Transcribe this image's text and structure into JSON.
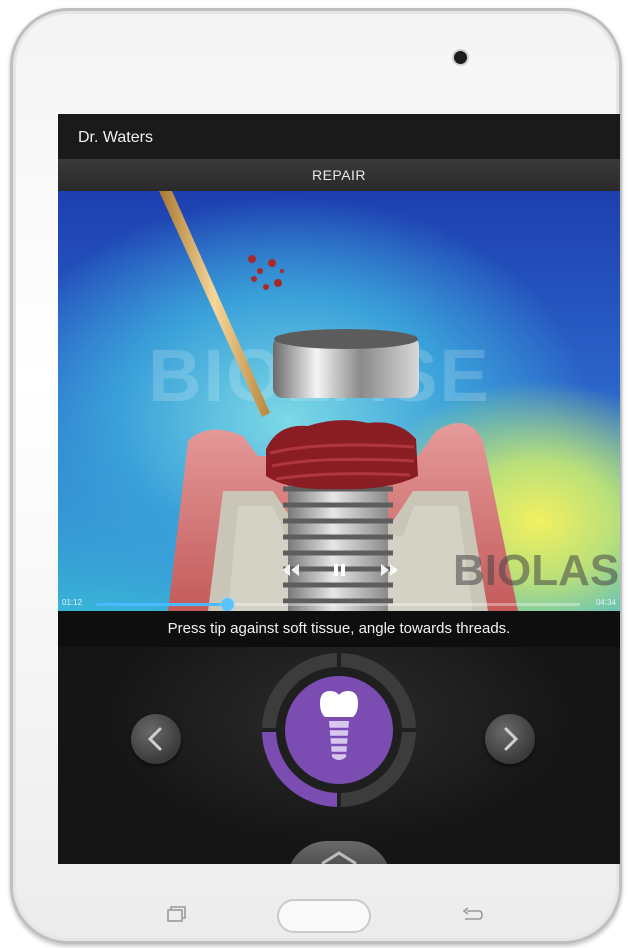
{
  "header": {
    "title": "Dr. Waters"
  },
  "section": {
    "label": "REPAIR"
  },
  "video": {
    "elapsed": "01:12",
    "duration": "04:34",
    "progress": 0.27,
    "watermark_center": "BIOLASE",
    "watermark_corner": "BIOLASE"
  },
  "caption": {
    "text": "Press tip against soft tissue, angle towards threads."
  },
  "icons": {
    "rewind": "rewind-icon",
    "pause": "pause-icon",
    "fast_forward": "fast-forward-icon",
    "prev": "chevron-left-icon",
    "next": "chevron-right-icon",
    "center": "dental-implant-icon",
    "bottom": "chevron-up-icon",
    "recent_apps": "recent-apps-icon",
    "back": "back-icon"
  },
  "colors": {
    "accent": "#7b4db3",
    "progress": "#4bb8ff"
  }
}
